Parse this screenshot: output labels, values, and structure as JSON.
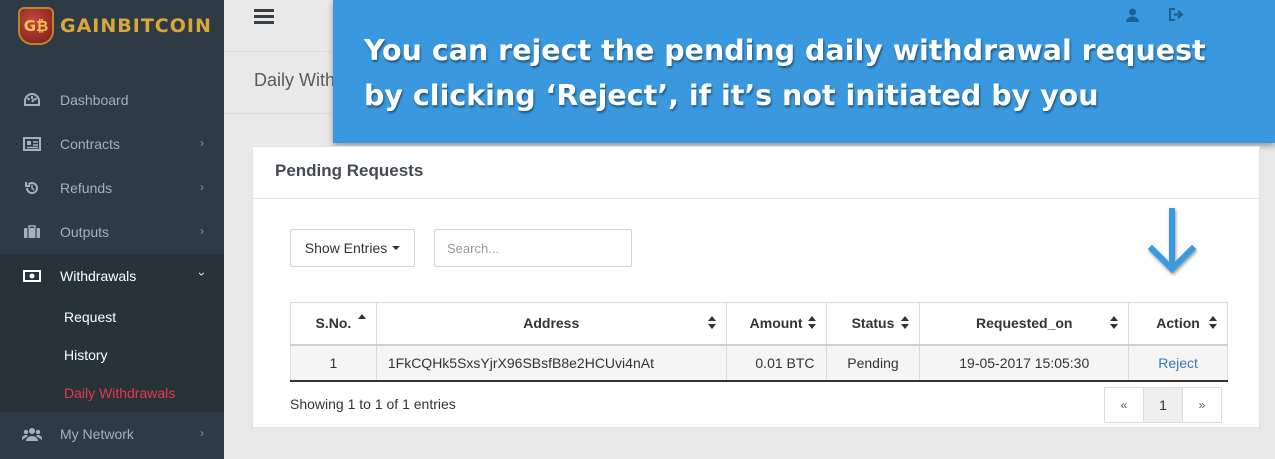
{
  "app": {
    "logo_initials": "G₿",
    "logo_text": "GAINBITCOIN"
  },
  "sidebar": {
    "items": [
      {
        "label": "Dashboard",
        "icon": "dashboard-icon"
      },
      {
        "label": "Contracts",
        "icon": "contracts-icon"
      },
      {
        "label": "Refunds",
        "icon": "refunds-icon"
      },
      {
        "label": "Outputs",
        "icon": "outputs-icon"
      },
      {
        "label": "Withdrawals",
        "icon": "withdrawals-icon"
      },
      {
        "label": "My Network",
        "icon": "network-icon"
      }
    ],
    "withdrawals_sub": [
      {
        "label": "Request"
      },
      {
        "label": "History"
      },
      {
        "label": "Daily Withdrawals"
      }
    ]
  },
  "page": {
    "title": "Daily Withdrawals"
  },
  "callout": {
    "line1": "You can reject the pending daily withdrawal request",
    "line2": "by clicking ‘Reject’, if it’s not initiated by you"
  },
  "panel": {
    "title": "Pending Requests",
    "show_entries_label": "Show Entries",
    "search_placeholder": "Search...",
    "table": {
      "headers": [
        "S.No.",
        "Address",
        "Amount",
        "Status",
        "Requested_on",
        "Action"
      ],
      "rows": [
        {
          "sno": "1",
          "address": "1FkCQHk5SxsYjrX96SBsfB8e2HCUvi4nAt",
          "amount": "0.01 BTC",
          "status": "Pending",
          "requested_on": "19-05-2017 15:05:30",
          "action": "Reject"
        }
      ]
    },
    "info": "Showing 1 to 1 of 1 entries",
    "pagination": {
      "prev": "«",
      "page": "1",
      "next": "»"
    }
  },
  "colors": {
    "sidebar": "#2e3b44",
    "callout": "#3a99de",
    "active_link": "#e8384f",
    "action_link": "#337ab7"
  }
}
